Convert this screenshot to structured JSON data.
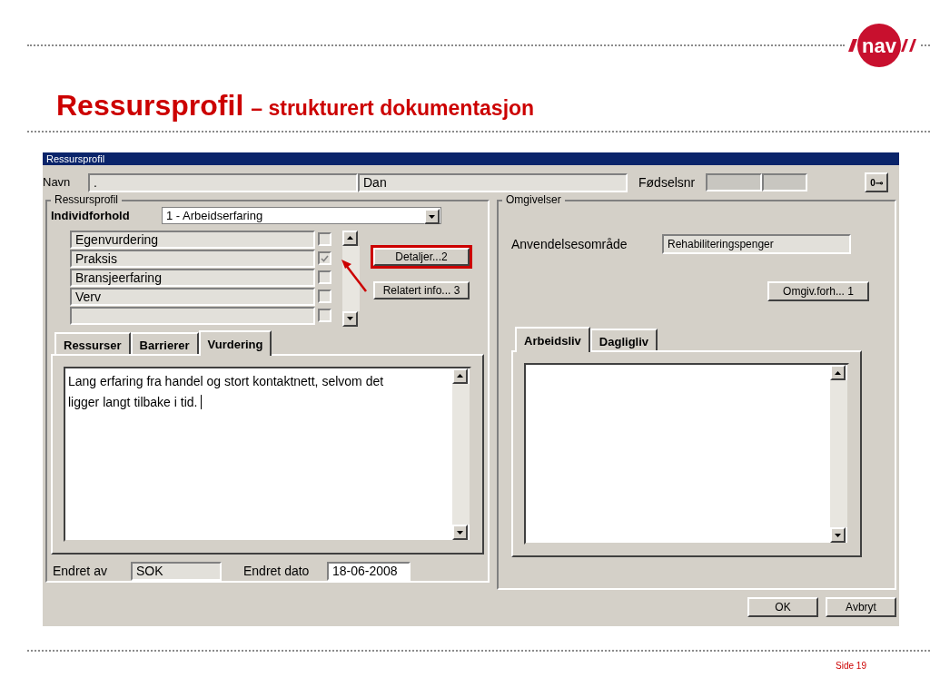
{
  "logo": {
    "text": "nav"
  },
  "slide_title": {
    "main": "Ressursprofil",
    "sub": "– strukturert dokumentasjon"
  },
  "window": {
    "title": "Ressursprofil",
    "header": {
      "name_label": "Navn",
      "name_fields": [
        ".",
        "Dan"
      ],
      "birth_label": "Fødselsnr",
      "key_button": "0⊸"
    },
    "left_group": {
      "title": "Ressursprofil",
      "individ_label": "Individforhold",
      "individ_value": "1 - Arbeidserfaring",
      "items": [
        {
          "label": "Egenvurdering",
          "checked": false
        },
        {
          "label": "Praksis",
          "checked": true
        },
        {
          "label": "Bransjeerfaring",
          "checked": false
        },
        {
          "label": "Verv",
          "checked": false
        },
        {
          "checked": false
        }
      ],
      "buttons": [
        {
          "label": "Detaljer...2",
          "highlighted": true
        },
        {
          "label": "Relatert info... 3",
          "highlighted": false
        }
      ],
      "tabs": [
        {
          "label": "Ressurser",
          "selected": false
        },
        {
          "label": "Barrierer",
          "selected": false
        },
        {
          "label": "Vurdering",
          "selected": true
        }
      ],
      "text": "Lang erfaring fra handel og stort kontaktnett, selvom det ligger langt tilbake i tid.",
      "changed_by_label": "Endret av",
      "changed_by": "SOK",
      "changed_date_label": "Endret dato",
      "changed_date": "18-06-2008"
    },
    "right_group": {
      "title": "Omgivelser",
      "area_label": "Anvendelsesområde",
      "area_value": "Rehabiliteringspenger",
      "button": "Omgiv.forh... 1",
      "tabs": [
        {
          "label": "Arbeidsliv",
          "selected": true
        },
        {
          "label": "Dagligliv",
          "selected": false
        }
      ]
    },
    "buttons": [
      "OK",
      "Avbryt"
    ]
  },
  "footer": {
    "page": "Side 19"
  }
}
